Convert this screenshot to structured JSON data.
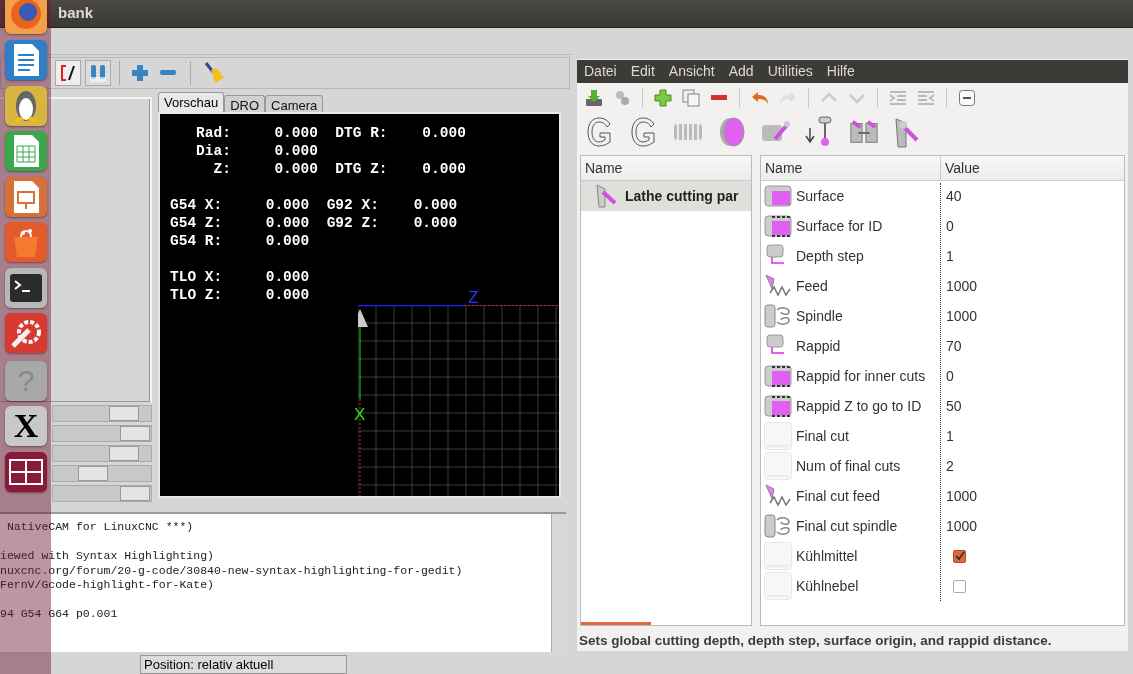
{
  "window": {
    "title": "bank"
  },
  "launcher": [
    {
      "kind": "globe"
    },
    {
      "kind": "document"
    },
    {
      "kind": "penguin"
    },
    {
      "kind": "spreadsheet"
    },
    {
      "kind": "presentation"
    },
    {
      "kind": "bag"
    },
    {
      "kind": "terminal"
    },
    {
      "kind": "tools"
    },
    {
      "kind": "help",
      "glyph": "?"
    },
    {
      "kind": "font",
      "glyph": "X"
    },
    {
      "kind": "workspace"
    }
  ],
  "sliders": [
    {
      "level": 0.8
    },
    {
      "level": 0.95
    },
    {
      "level": 0.8
    },
    {
      "level": 0.35
    },
    {
      "level": 0.95
    }
  ],
  "tabs": [
    {
      "label": "Vorschau",
      "selected": true
    },
    {
      "label": "DRO",
      "selected": false
    },
    {
      "label": "Camera",
      "selected": false
    }
  ],
  "dro": [
    [
      "   Rad:     0.000  DTG R:    0.000",
      "   Dia:     0.000",
      "     Z:     0.000  DTG Z:    0.000"
    ],
    [
      "G54 X:     0.000  G92 X:    0.000",
      "G54 Z:     0.000  G92 Z:    0.000",
      "G54 R:     0.000"
    ],
    [
      "TLO X:     0.000",
      "TLO Z:     0.000"
    ]
  ],
  "preview": {
    "axis_z": "Z",
    "axis_x": "X"
  },
  "code_blocks": [
    [
      " NativeCAM for LinuxCNC ***)"
    ],
    [
      "iewed with Syntax Highlighting)",
      "nuxcnc.org/forum/20-g-code/30840-new-syntax-highlighting-for-gedit)",
      "FernV/Gcode-highlight-for-Kate)"
    ],
    [
      "94 G54 G64 p0.001"
    ]
  ],
  "status_bar": {
    "position": "Position: relativ aktuell"
  },
  "nativecam": {
    "menu": [
      "Datei",
      "Edit",
      "Ansicht",
      "Add",
      "Utilities",
      "Hilfe"
    ],
    "tree": {
      "column": "Name",
      "items": [
        {
          "label": "Lathe cutting par",
          "selected": true
        }
      ]
    },
    "table": {
      "columns": [
        "Name",
        "Value"
      ],
      "rows": [
        {
          "name": "Surface",
          "kind": "text",
          "value": "40"
        },
        {
          "name": "Surface for ID",
          "kind": "text",
          "value": "0"
        },
        {
          "name": "Depth step",
          "kind": "text",
          "value": "1"
        },
        {
          "name": "Feed",
          "kind": "text",
          "value": "1000"
        },
        {
          "name": "Spindle",
          "kind": "text",
          "value": "1000"
        },
        {
          "name": "Rappid",
          "kind": "text",
          "value": "70"
        },
        {
          "name": "Rappid for inner cuts",
          "kind": "text",
          "value": "0"
        },
        {
          "name": "Rappid Z to go to ID",
          "kind": "text",
          "value": "50"
        },
        {
          "name": "Final cut",
          "kind": "text",
          "value": "1"
        },
        {
          "name": "Num of final cuts",
          "kind": "text",
          "value": "2"
        },
        {
          "name": "Final cut feed",
          "kind": "text",
          "value": "1000"
        },
        {
          "name": "Final cut spindle",
          "kind": "text",
          "value": "1000"
        },
        {
          "name": "Kühlmittel",
          "kind": "check",
          "checked": true
        },
        {
          "name": "Kühlnebel",
          "kind": "check",
          "checked": false
        }
      ]
    },
    "hint": "Sets global cutting depth, depth step, surface origin, and rappid distance."
  }
}
